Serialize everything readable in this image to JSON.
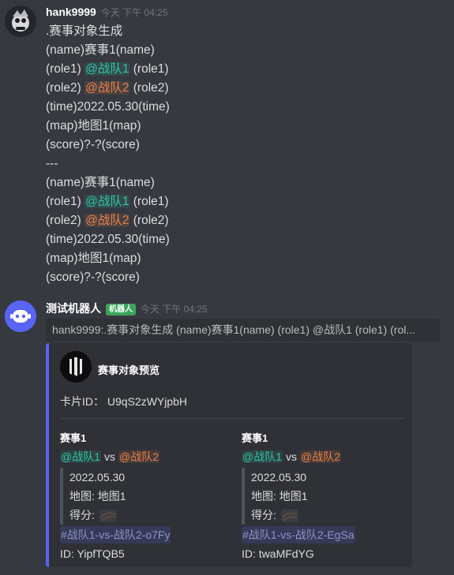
{
  "message1": {
    "username": "hank9999",
    "timestamp": "今天 下午 04:25",
    "lines": [
      [
        {
          "text": ".赛事对象生成"
        }
      ],
      [
        {
          "text": "(name)赛事1(name)"
        }
      ],
      [
        {
          "text": "(role1) "
        },
        {
          "text": "@战队1",
          "mention": "green"
        },
        {
          "text": " (role1)"
        }
      ],
      [
        {
          "text": "(role2) "
        },
        {
          "text": "@战队2",
          "mention": "orange"
        },
        {
          "text": " (role2)"
        }
      ],
      [
        {
          "text": "(time)2022.05.30(time)"
        }
      ],
      [
        {
          "text": "(map)地图1(map)"
        }
      ],
      [
        {
          "text": "(score)?-?(score)"
        }
      ],
      [
        {
          "text": "---"
        }
      ],
      [
        {
          "text": "(name)赛事1(name)"
        }
      ],
      [
        {
          "text": "(role1) "
        },
        {
          "text": "@战队1",
          "mention": "green"
        },
        {
          "text": " (role1)"
        }
      ],
      [
        {
          "text": "(role2) "
        },
        {
          "text": "@战队2",
          "mention": "orange"
        },
        {
          "text": " (role2)"
        }
      ],
      [
        {
          "text": "(time)2022.05.30(time)"
        }
      ],
      [
        {
          "text": "(map)地图1(map)"
        }
      ],
      [
        {
          "text": "(score)?-?(score)"
        }
      ]
    ]
  },
  "message2": {
    "username": "测试机器人",
    "bot_tag": "机器人",
    "timestamp": "今天 下午 04:25",
    "reference": "hank9999:.赛事对象生成 (name)赛事1(name) (role1) @战队1 (role1) (rol...",
    "embed": {
      "accent_color": "#5865f2",
      "title": "赛事对象预览",
      "card_id": "卡片ID：  U9qS2zWYjpbH",
      "fields": [
        {
          "name": "赛事1",
          "team1": "@战队1",
          "vs": "vs",
          "team2": "@战队2",
          "date": "2022.05.30",
          "map": "地图: 地图1",
          "score_label": "得分:",
          "channel": "#战队1-vs-战队2-o7Fy",
          "id": "ID: YipfTQB5"
        },
        {
          "name": "赛事1",
          "team1": "@战队1",
          "vs": "vs",
          "team2": "@战队2",
          "date": "2022.05.30",
          "map": "地图: 地图1",
          "score_label": "得分:",
          "channel": "#战队1-vs-战队2-EgSa",
          "id": "ID: twaMFdYG"
        }
      ]
    }
  },
  "colors": {
    "background": "#36393f",
    "mention_green": "#2ec4a6",
    "mention_orange": "#e8804a",
    "bot_tag": "#3ba55d"
  }
}
